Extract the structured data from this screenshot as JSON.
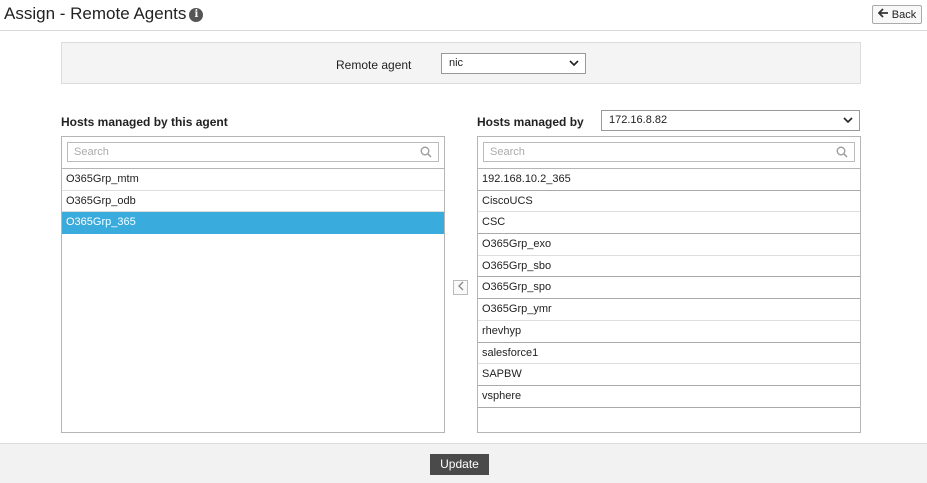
{
  "header": {
    "title": "Assign - Remote Agents",
    "info_icon": "info-circle-icon",
    "back_label": "Back",
    "back_icon": "back-arrow-icon"
  },
  "agent_panel": {
    "label": "Remote agent",
    "selected": "nic"
  },
  "left_list": {
    "title": "Hosts managed by this agent",
    "search_placeholder": "Search",
    "items": [
      {
        "label": "O365Grp_mtm",
        "selected": false
      },
      {
        "label": "O365Grp_odb",
        "selected": false
      },
      {
        "label": "O365Grp_365",
        "selected": true
      }
    ]
  },
  "right_list": {
    "title": "Hosts managed by",
    "selected_host": "172.16.8.82",
    "search_placeholder": "Search",
    "items": [
      "192.168.10.2_365",
      "CiscoUCS",
      "CSC",
      "O365Grp_exo",
      "O365Grp_sbo",
      "O365Grp_spo",
      "O365Grp_ymr",
      "rhevhyp",
      "salesforce1",
      "SAPBW",
      "vsphere"
    ]
  },
  "move_button_icon": "chevron-left-icon",
  "footer": {
    "update_label": "Update"
  },
  "colors": {
    "selected_row": "#3aabdd",
    "update_button": "#4a4a4a"
  }
}
